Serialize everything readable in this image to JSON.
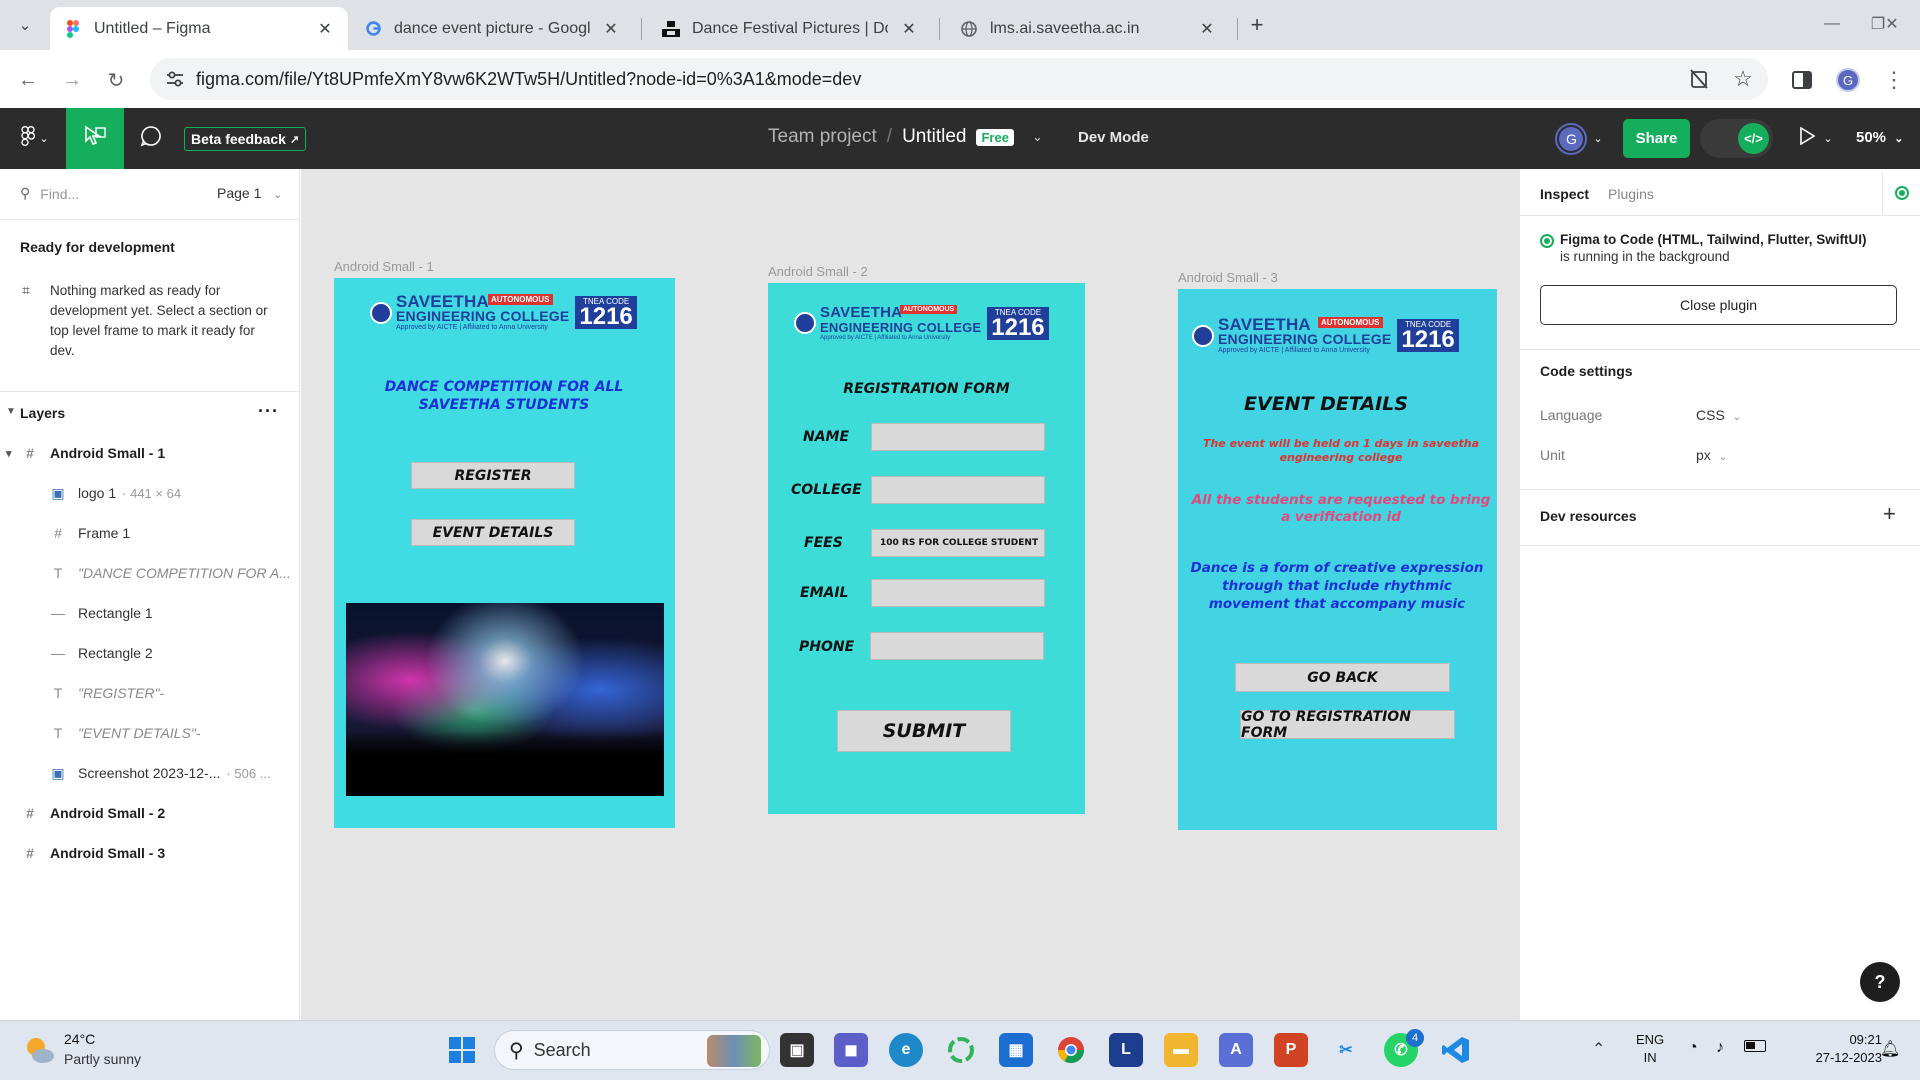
{
  "browser": {
    "tabs": [
      {
        "title": "Untitled – Figma",
        "favicon": "figma-icon"
      },
      {
        "title": "dance event picture - Google Se",
        "favicon": "google-icon"
      },
      {
        "title": "Dance Festival Pictures | Downlo",
        "favicon": "unsplash-icon"
      },
      {
        "title": "lms.ai.saveetha.ac.in",
        "favicon": "globe-icon"
      }
    ],
    "url": "figma.com/file/Yt8UPmfeXmY8vw6K2WTw5H/Untitled?node-id=0%3A1&mode=dev",
    "profile_initial": "G"
  },
  "figma": {
    "beta_feedback": "Beta feedback",
    "team": "Team project",
    "file": "Untitled",
    "plan_badge": "Free",
    "dev_mode": "Dev Mode",
    "user_initial": "G",
    "share": "Share",
    "zoom": "50%"
  },
  "left_panel": {
    "find_placeholder": "Find...",
    "page": "Page 1",
    "ready_title": "Ready for development",
    "ready_message": "Nothing marked as ready for development yet. Select a section or top level frame to mark it ready for dev.",
    "layers_title": "Layers",
    "layers": [
      {
        "name": "Android Small - 1",
        "kind": "frame",
        "level": 0
      },
      {
        "name": "logo 1",
        "dim": "· 441 × 64",
        "kind": "image",
        "level": 1
      },
      {
        "name": "Frame 1",
        "kind": "frame",
        "level": 1
      },
      {
        "name": "\"DANCE COMPETITION FOR A...",
        "kind": "text",
        "level": 1
      },
      {
        "name": "Rectangle 1",
        "kind": "rect",
        "level": 1
      },
      {
        "name": "Rectangle 2",
        "kind": "rect",
        "level": 1
      },
      {
        "name": "\"REGISTER\"-",
        "kind": "text",
        "level": 1
      },
      {
        "name": "\"EVENT DETAILS\"-",
        "kind": "text",
        "level": 1
      },
      {
        "name": "Screenshot 2023-12-...",
        "dim": "· 506 ...",
        "kind": "image",
        "level": 1
      },
      {
        "name": "Android Small - 2",
        "kind": "frame",
        "level": 0
      },
      {
        "name": "Android Small - 3",
        "kind": "frame",
        "level": 0
      }
    ]
  },
  "canvas": {
    "logo": {
      "name_line1": "SAVEETHA",
      "name_line2": "ENGINEERING COLLEGE",
      "autonomous": "AUTONOMOUS",
      "sub": "Approved by AICTE | Affiliated to Anna University",
      "code_label": "TNEA CODE",
      "code": "1216"
    },
    "frame1": {
      "label": "Android Small - 1",
      "heading": "DANCE COMPETITION FOR ALL SAVEETHA STUDENTS",
      "register": "REGISTER",
      "event_details": "EVENT DETAILS"
    },
    "frame2": {
      "label": "Android Small - 2",
      "heading": "REGISTRATION FORM",
      "fields": [
        {
          "label": "NAME",
          "value": ""
        },
        {
          "label": "COLLEGE",
          "value": ""
        },
        {
          "label": "FEES",
          "value": "100 RS FOR COLLEGE STUDENT"
        },
        {
          "label": "EMAIL",
          "value": ""
        },
        {
          "label": "PHONE",
          "value": ""
        }
      ],
      "submit": "SUBMIT"
    },
    "frame3": {
      "label": "Android Small - 3",
      "heading": "EVENT DETAILS",
      "line1": "The event will be held on 1 days in saveetha engineering college",
      "line2": "All the students are requested to bring a verification id",
      "line3": "Dance is a form of creative expression through that include rhythmic movement that accompany music",
      "go_back": "GO BACK",
      "go_reg": "GO TO REGISTRATION FORM"
    }
  },
  "right_panel": {
    "tab_inspect": "Inspect",
    "tab_plugins": "Plugins",
    "plugin_name": "Figma to Code (HTML, Tailwind, Flutter, SwiftUI)",
    "plugin_status": "is running in the background",
    "close_plugin": "Close plugin",
    "code_settings": "Code settings",
    "language_label": "Language",
    "language_value": "CSS",
    "unit_label": "Unit",
    "unit_value": "px",
    "dev_resources": "Dev resources"
  },
  "taskbar": {
    "temperature": "24°C",
    "weather": "Partly sunny",
    "search": "Search",
    "lang1": "ENG",
    "lang2": "IN",
    "time": "09:21",
    "date": "27-12-2023",
    "whatsapp_badge": "4"
  },
  "colors": {
    "figma_dark": "#2c2c2c",
    "figma_green": "#14ae5c",
    "frame_cyan": "#41dbe3",
    "canvas_bg": "#e5e5e5",
    "heading_blue": "#1a2fd6",
    "event_red": "#e0322f",
    "event_pink": "#e4487a"
  }
}
